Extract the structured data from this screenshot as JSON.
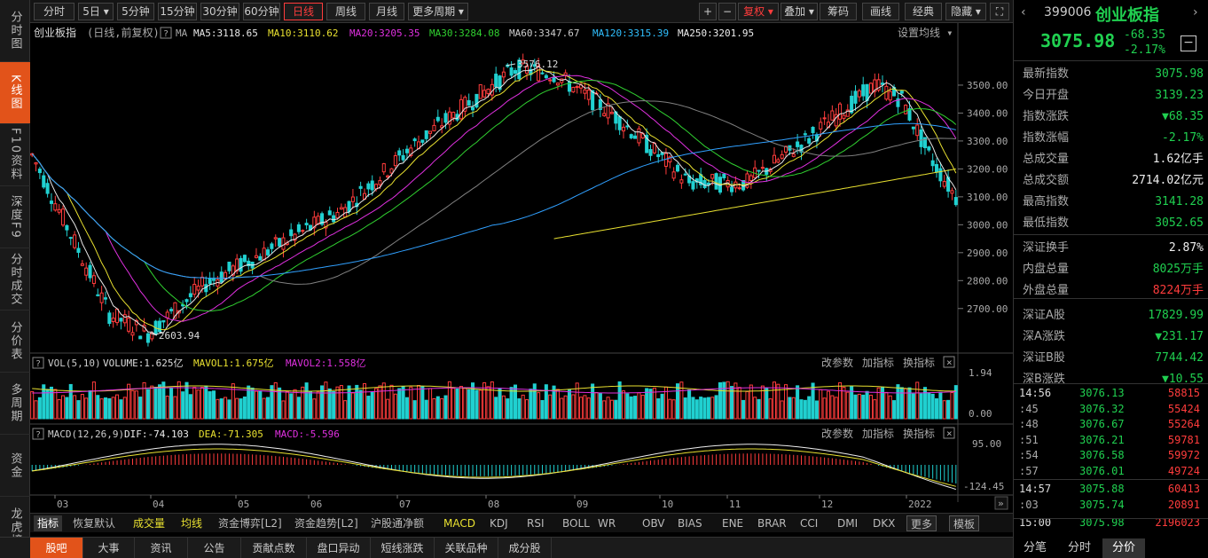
{
  "left_nav": [
    {
      "label": "分时图",
      "active": false
    },
    {
      "label": "K线图",
      "active": true
    },
    {
      "label": "F10资料",
      "active": false
    },
    {
      "label": "深度F9",
      "active": false
    },
    {
      "label": "分时成交",
      "active": false
    },
    {
      "label": "分价表",
      "active": false
    },
    {
      "label": "多周期",
      "active": false
    },
    {
      "label": "资金",
      "active": false
    },
    {
      "label": "龙虎榜",
      "active": false
    }
  ],
  "periods": [
    "分时",
    "5日",
    "5分钟",
    "15分钟",
    "30分钟",
    "60分钟",
    "日线",
    "周线",
    "月线",
    "更多周期"
  ],
  "active_period": "日线",
  "toolbar_right": {
    "plus": "+",
    "minus": "−",
    "fuquan": "复权",
    "diejia": "叠加",
    "chouma": "筹码",
    "huaxian": "画线",
    "jingdian": "经典",
    "yincang": "隐藏"
  },
  "chart_header": {
    "name": "创业板指",
    "mode": "(日线,前复权)",
    "ma_label": "MA",
    "ma5": "MA5:3118.65",
    "ma10": "MA10:3110.62",
    "ma20": "MA20:3205.35",
    "ma30": "MA30:3284.08",
    "ma60": "MA60:3347.67",
    "ma120": "MA120:3315.39",
    "ma250": "MA250:3201.95",
    "settings": "设置均线"
  },
  "price_axis": [
    "3500.00",
    "3400.00",
    "3300.00",
    "3200.00",
    "3100.00",
    "3000.00",
    "2900.00",
    "2800.00",
    "2700.00"
  ],
  "annotations": {
    "high": "3576.12",
    "low": "2603.94"
  },
  "vol_header": {
    "name": "VOL(5,10)",
    "volume": "VOLUME:1.625亿",
    "mavol1": "MAVOL1:1.675亿",
    "mavol2": "MAVOL2:1.558亿",
    "param": "改参数",
    "add": "加指标",
    "switch": "换指标"
  },
  "vol_axis": [
    "1.94",
    "0.00"
  ],
  "macd_header": {
    "name": "MACD(12,26,9)",
    "dif": "DIF:-74.103",
    "dea": "DEA:-71.305",
    "macd": "MACD:-5.596",
    "param": "改参数",
    "add": "加指标",
    "switch": "换指标"
  },
  "macd_axis": [
    "95.00",
    "-124.45"
  ],
  "months": [
    "03",
    "04",
    "05",
    "06",
    "07",
    "08",
    "09",
    "10",
    "11",
    "12",
    "2022"
  ],
  "indicator_tabs": [
    "指标",
    "恢复默认",
    "成交量",
    "均线",
    "资金博弈[L2]",
    "资金趋势[L2]",
    "沪股通净额",
    "MACD",
    "KDJ",
    "RSI",
    "BOLL",
    "WR",
    "OBV",
    "BIAS",
    "ENE",
    "BRAR",
    "CCI",
    "DMI",
    "DKX",
    "更多",
    "模板"
  ],
  "footer_tabs": [
    "股吧",
    "大事",
    "资讯",
    "公告",
    "贡献点数",
    "盘口异动",
    "短线涨跌",
    "关联品种",
    "成分股"
  ],
  "quote": {
    "code": "399006",
    "name": "创业板指",
    "price": "3075.98",
    "change": "-68.35",
    "pct": "-2.17%",
    "rows": [
      {
        "label": "最新指数",
        "value": "3075.98",
        "color": "green"
      },
      {
        "label": "今日开盘",
        "value": "3139.23",
        "color": "green"
      },
      {
        "label": "指数涨跌",
        "value": "▼68.35",
        "color": "green"
      },
      {
        "label": "指数涨幅",
        "value": "-2.17%",
        "color": "green"
      },
      {
        "label": "总成交量",
        "value": "1.62亿手",
        "color": "white"
      },
      {
        "label": "总成交额",
        "value": "2714.02亿元",
        "color": "white"
      },
      {
        "label": "最高指数",
        "value": "3141.28",
        "color": "green"
      },
      {
        "label": "最低指数",
        "value": "3052.65",
        "color": "green"
      },
      {
        "label": "深证换手",
        "value": "2.87%",
        "color": "white"
      },
      {
        "label": "内盘总量",
        "value": "8025万手",
        "color": "green"
      },
      {
        "label": "外盘总量",
        "value": "8224万手",
        "color": "red"
      },
      {
        "label": "深证A股",
        "value": "17829.99",
        "color": "green"
      },
      {
        "label": "深A涨跌",
        "value": "▼231.17",
        "color": "green"
      },
      {
        "label": "深证B股",
        "value": "7744.42",
        "color": "green"
      },
      {
        "label": "深B涨跌",
        "value": "▼10.55",
        "color": "green"
      }
    ],
    "ticks": [
      {
        "time": "14:56",
        "price": "3076.13",
        "vol": "58815"
      },
      {
        "time": ":45",
        "price": "3076.32",
        "vol": "55424"
      },
      {
        "time": ":48",
        "price": "3076.67",
        "vol": "55264"
      },
      {
        "time": ":51",
        "price": "3076.21",
        "vol": "59781"
      },
      {
        "time": ":54",
        "price": "3076.58",
        "vol": "59972"
      },
      {
        "time": ":57",
        "price": "3076.01",
        "vol": "49724"
      },
      {
        "time": "14:57",
        "price": "3075.88",
        "vol": "60413"
      },
      {
        "time": ":03",
        "price": "3075.74",
        "vol": "20891"
      },
      {
        "time": "15:00",
        "price": "3075.98",
        "vol": "2196023"
      }
    ],
    "tabs": [
      "分笔",
      "分时",
      "分价"
    ]
  },
  "colors": {
    "up": "#ff3c3c",
    "down": "#20d0d0",
    "ma5": "#e8e8e8",
    "ma10": "#e8e030",
    "ma20": "#e030e0",
    "ma30": "#30d030",
    "ma60": "#808080",
    "ma120": "#30a0ff",
    "ma250": "#e8e030"
  }
}
